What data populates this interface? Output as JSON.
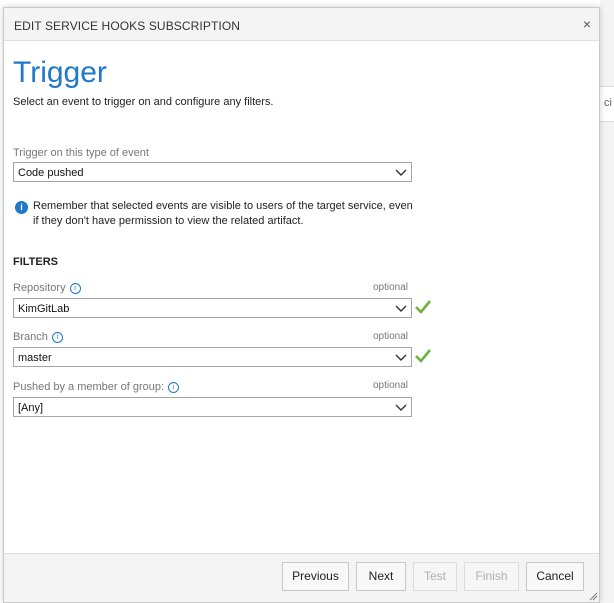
{
  "background": {
    "cut_text": "ci"
  },
  "dialog": {
    "title": "EDIT SERVICE HOOKS SUBSCRIPTION",
    "close_icon": "×",
    "heading": "Trigger",
    "subheading": "Select an event to trigger on and configure any filters."
  },
  "trigger": {
    "label": "Trigger on this type of event",
    "value": "Code pushed",
    "info_text": "Remember that selected events are visible to users of the target service, even if they don't have permission to view the related artifact."
  },
  "filters": {
    "heading": "FILTERS",
    "repository": {
      "label": "Repository",
      "optional": "optional",
      "value": "KimGitLab",
      "valid": true
    },
    "branch": {
      "label": "Branch",
      "optional": "optional",
      "value": "master",
      "valid": true
    },
    "group": {
      "label": "Pushed by a member of group:",
      "optional": "optional",
      "value": "[Any]"
    }
  },
  "footer": {
    "previous": "Previous",
    "next": "Next",
    "test": "Test",
    "finish": "Finish",
    "cancel": "Cancel"
  },
  "colors": {
    "accent": "#1f78c8",
    "check": "#6cb33f"
  }
}
